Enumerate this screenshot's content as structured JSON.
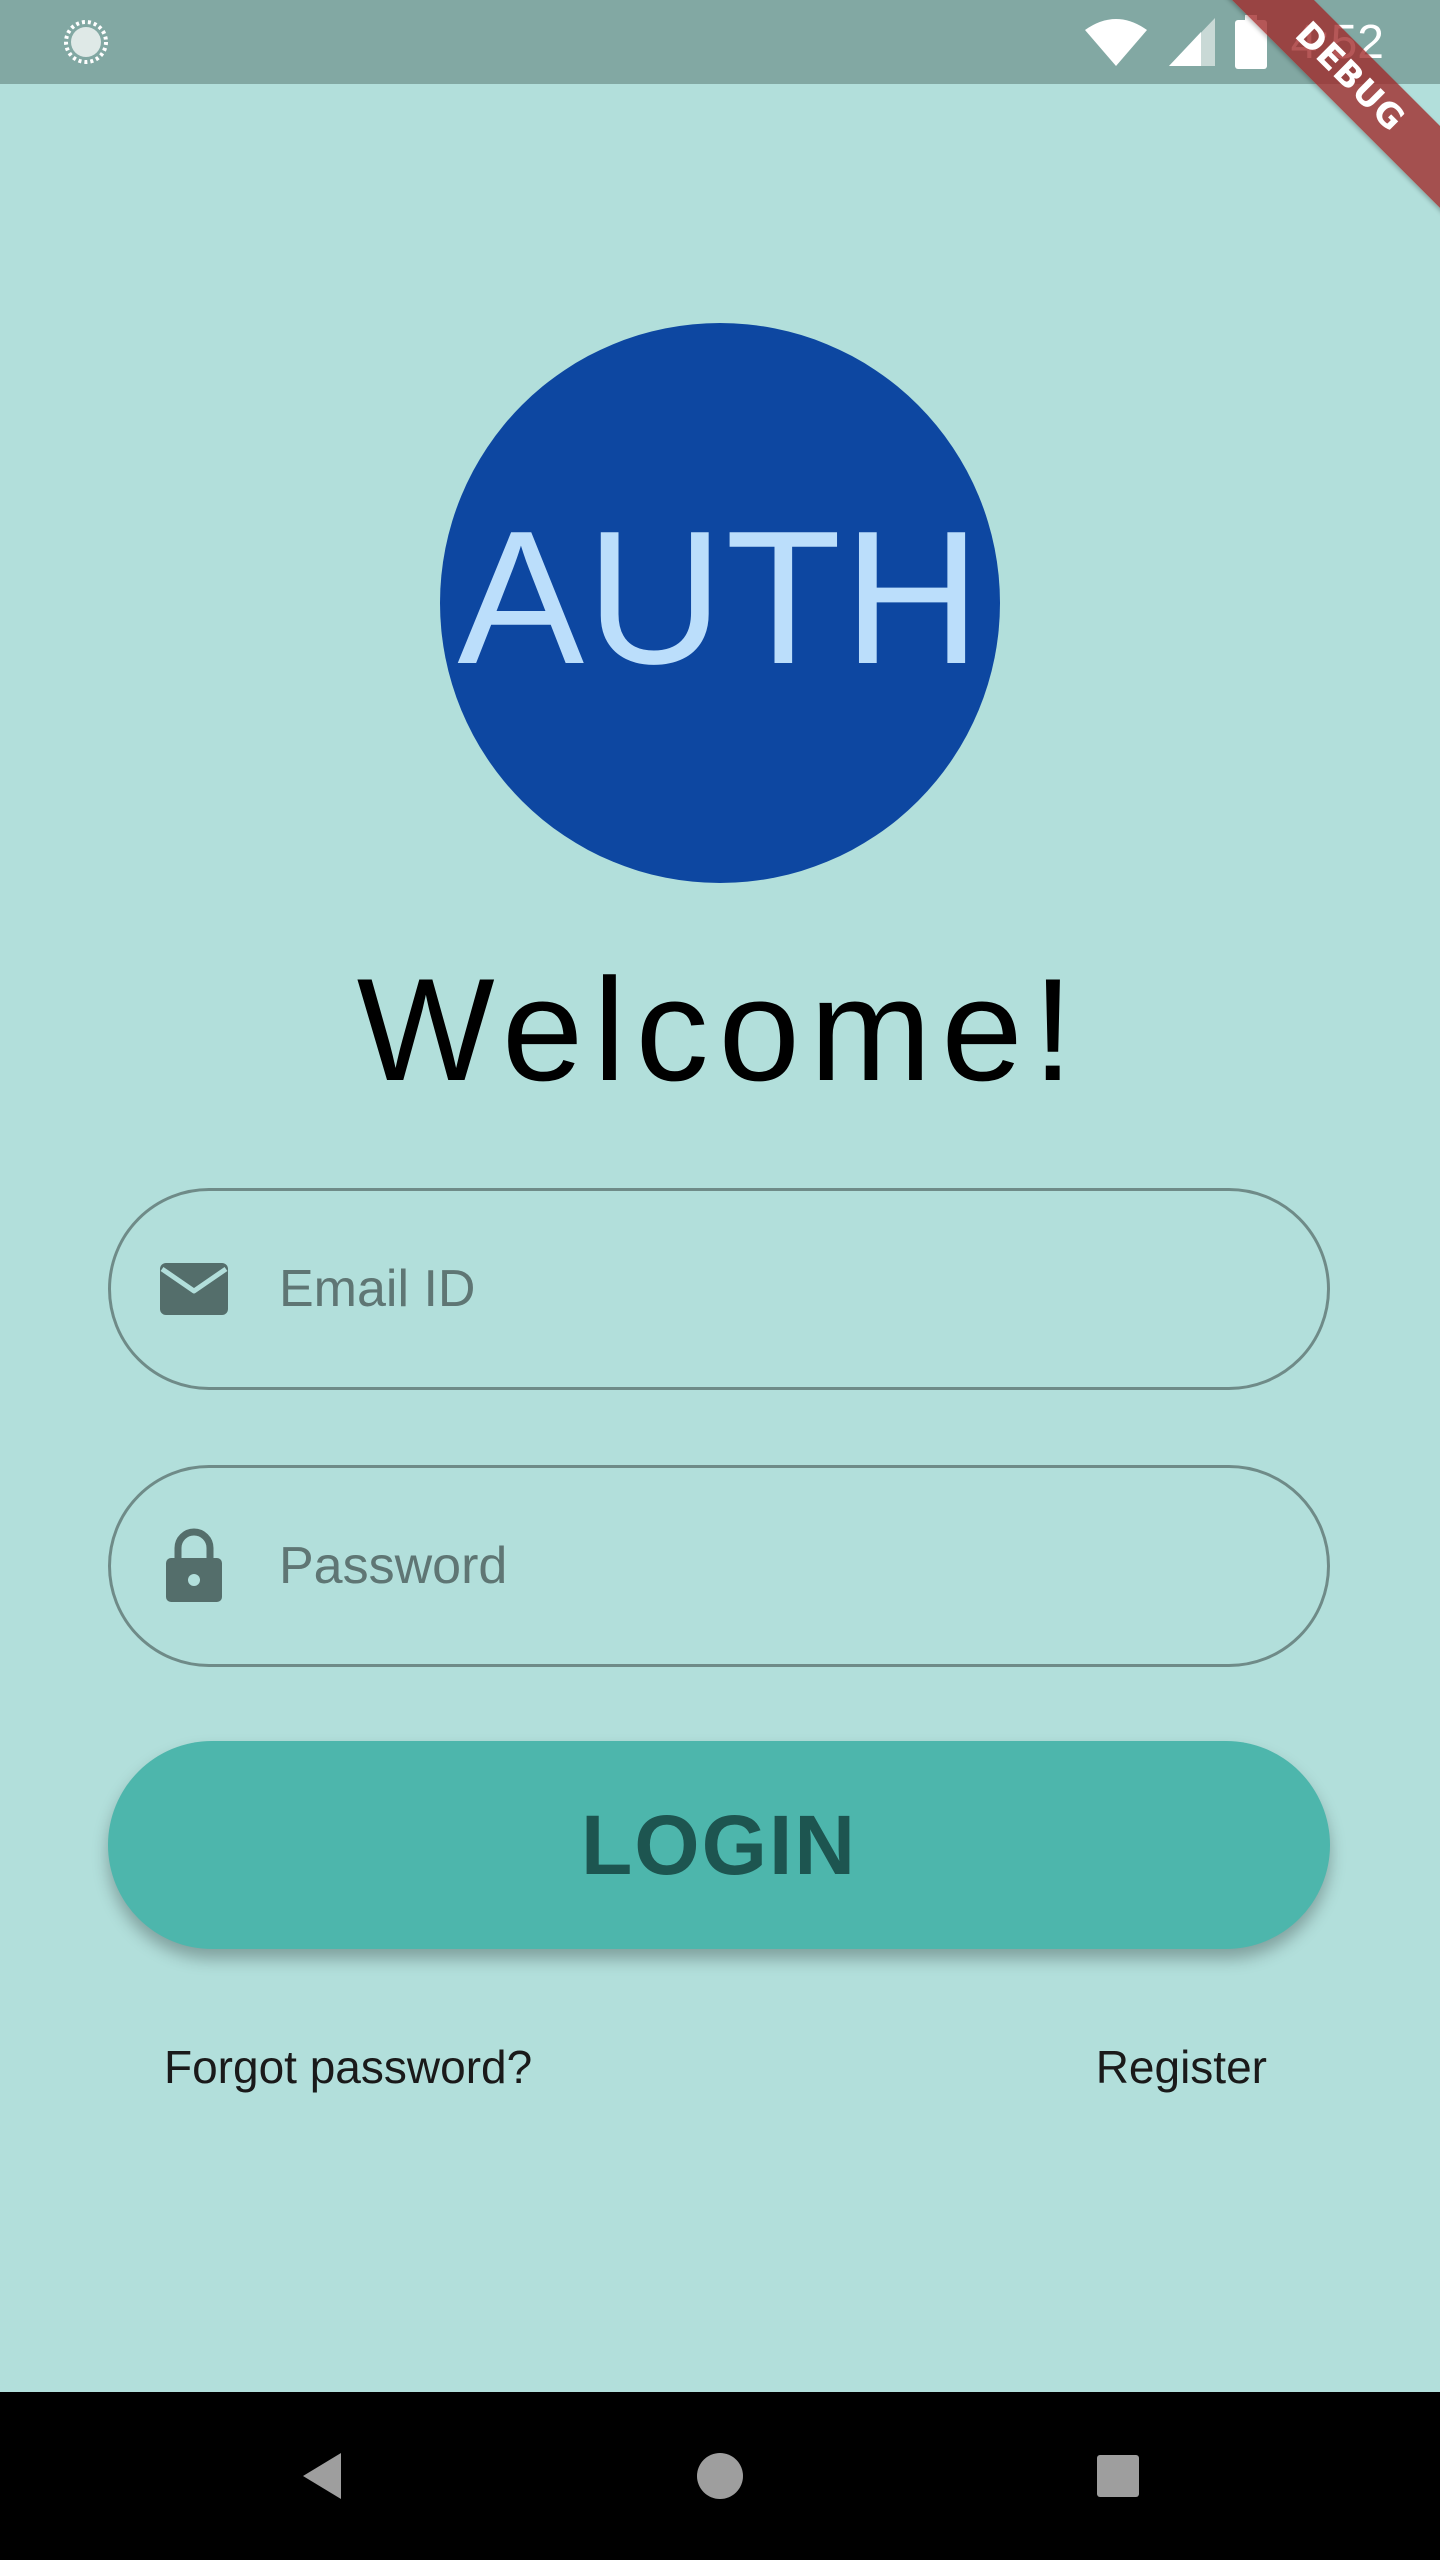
{
  "status_bar": {
    "time": "4:52",
    "icons": [
      "loading-circle-icon",
      "wifi-icon",
      "cellular-signal-icon",
      "battery-icon"
    ]
  },
  "debug_banner": {
    "label": "DEBUG"
  },
  "logo": {
    "text": "AUTH",
    "background_color": "#0d47a1",
    "text_color": "#bbdefb"
  },
  "welcome": {
    "title": "Welcome!"
  },
  "email_field": {
    "placeholder": "Email ID",
    "value": "",
    "icon": "mail-icon"
  },
  "password_field": {
    "placeholder": "Password",
    "value": "",
    "icon": "lock-icon"
  },
  "login_button": {
    "label": "LOGIN",
    "color": "#4db6ac"
  },
  "links": {
    "forgot_password": "Forgot password?",
    "register": "Register"
  },
  "navigation": {
    "buttons": [
      "back-icon",
      "home-icon",
      "recents-icon"
    ]
  },
  "colors": {
    "background": "#b2dfdb",
    "status_bar": "#82a8a3",
    "nav_bar": "#000000"
  }
}
